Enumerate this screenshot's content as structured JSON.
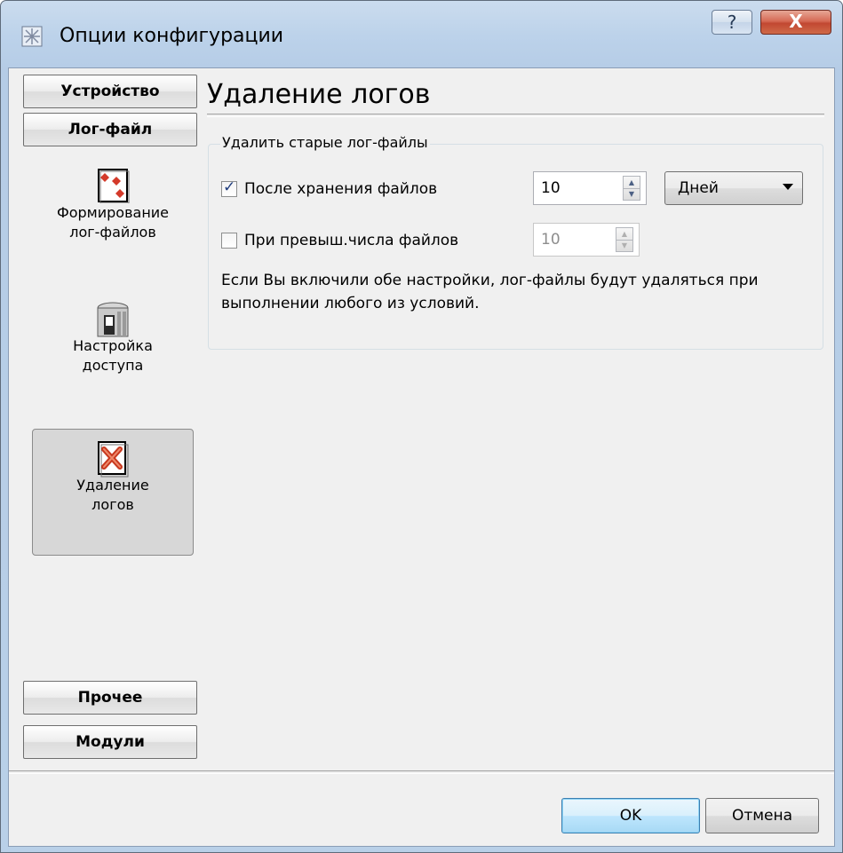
{
  "window": {
    "title": "Опции конфигурации",
    "help_label": "?",
    "close_label": "X"
  },
  "sidebar": {
    "top_sections": [
      "Устройство",
      "Лог-файл"
    ],
    "items": [
      {
        "label_line1": "Формирование",
        "label_line2": "лог-файлов",
        "icon": "log-generation-icon",
        "selected": false
      },
      {
        "label_line1": "Настройка",
        "label_line2": "доступа",
        "icon": "access-settings-icon",
        "selected": false
      },
      {
        "label_line1": "Удаление",
        "label_line2": "логов",
        "icon": "delete-logs-icon",
        "selected": true
      }
    ],
    "bottom_sections": [
      "Прочее",
      "Модули"
    ]
  },
  "main": {
    "title": "Удаление логов",
    "group_title": "Удалить старые лог-файлы",
    "option1": {
      "label": "После хранения файлов",
      "checked": true,
      "value": "10",
      "unit": "Дней"
    },
    "option2": {
      "label": "При превыш.числа файлов",
      "checked": false,
      "value": "10"
    },
    "note": "Если Вы включили обе настройки, лог-файлы будут удаляться при выполнении любого из условий."
  },
  "footer": {
    "ok_label": "OK",
    "cancel_label": "Отмена"
  },
  "colors": {
    "titlebar": "#bcd2ea",
    "client": "#f0f0f0",
    "close_button": "#c24832",
    "selected_item": "#d7d7d7"
  }
}
